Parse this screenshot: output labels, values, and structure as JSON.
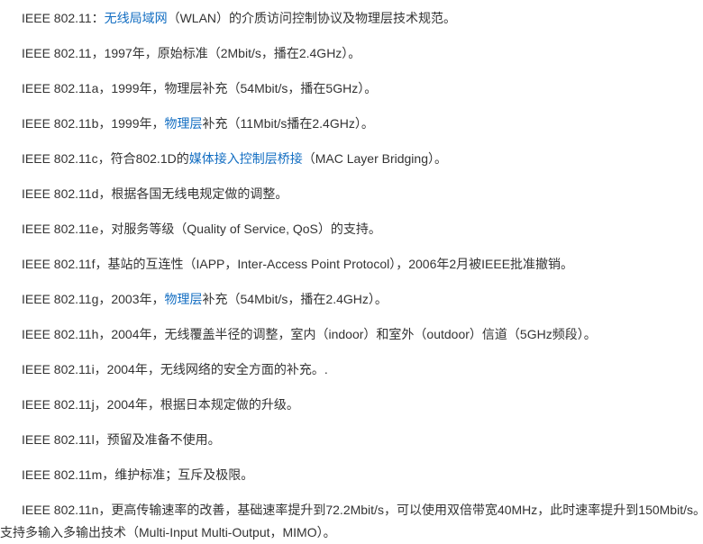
{
  "items": [
    {
      "parts": [
        {
          "text": "IEEE 802.11："
        },
        {
          "text": "无线局域网",
          "link": true
        },
        {
          "text": "（WLAN）的介质访问控制协议及物理层技术规范。"
        }
      ]
    },
    {
      "parts": [
        {
          "text": "IEEE 802.11，1997年，原始标准（2Mbit/s，播在2.4GHz）。"
        }
      ]
    },
    {
      "parts": [
        {
          "text": "IEEE 802.11a，1999年，物理层补充（54Mbit/s，播在5GHz）。"
        }
      ]
    },
    {
      "parts": [
        {
          "text": "IEEE 802.11b，1999年，"
        },
        {
          "text": "物理层",
          "link": true
        },
        {
          "text": "补充（11Mbit/s播在2.4GHz）。"
        }
      ]
    },
    {
      "parts": [
        {
          "text": "IEEE 802.11c，符合802.1D的"
        },
        {
          "text": "媒体接入控制层桥接",
          "link": true
        },
        {
          "text": "（MAC Layer Bridging）。"
        }
      ]
    },
    {
      "parts": [
        {
          "text": "IEEE 802.11d，根据各国无线电规定做的调整。"
        }
      ]
    },
    {
      "parts": [
        {
          "text": "IEEE 802.11e，对服务等级（Quality of Service, QoS）的支持。"
        }
      ]
    },
    {
      "parts": [
        {
          "text": "IEEE 802.11f，基站的互连性（IAPP，Inter-Access Point Protocol），2006年2月被IEEE批准撤销。"
        }
      ]
    },
    {
      "parts": [
        {
          "text": "IEEE 802.11g，2003年，"
        },
        {
          "text": "物理层",
          "link": true
        },
        {
          "text": "补充（54Mbit/s，播在2.4GHz）。"
        }
      ]
    },
    {
      "parts": [
        {
          "text": "IEEE 802.11h，2004年，无线覆盖半径的调整，室内（indoor）和室外（outdoor）信道（5GHz频段）。"
        }
      ]
    },
    {
      "parts": [
        {
          "text": "IEEE 802.11i，2004年，无线网络的安全方面的补充。."
        }
      ]
    },
    {
      "parts": [
        {
          "text": "IEEE 802.11j，2004年，根据日本规定做的升级。"
        }
      ]
    },
    {
      "parts": [
        {
          "text": "IEEE 802.11l，预留及准备不使用。"
        }
      ]
    },
    {
      "parts": [
        {
          "text": "IEEE 802.11m，维护标准；互斥及极限。"
        }
      ]
    },
    {
      "parts": [
        {
          "text": "IEEE 802.11n，更高传输速率的改善，基础速率提升到72.2Mbit/s，可以使用双倍带宽40MHz，此时速率提升到150Mbit/s。"
        }
      ]
    },
    {
      "parts": [
        {
          "text": "支持多输入多输出技术（Multi-Input Multi-Output，MIMO）。"
        }
      ],
      "continuation": true
    }
  ]
}
